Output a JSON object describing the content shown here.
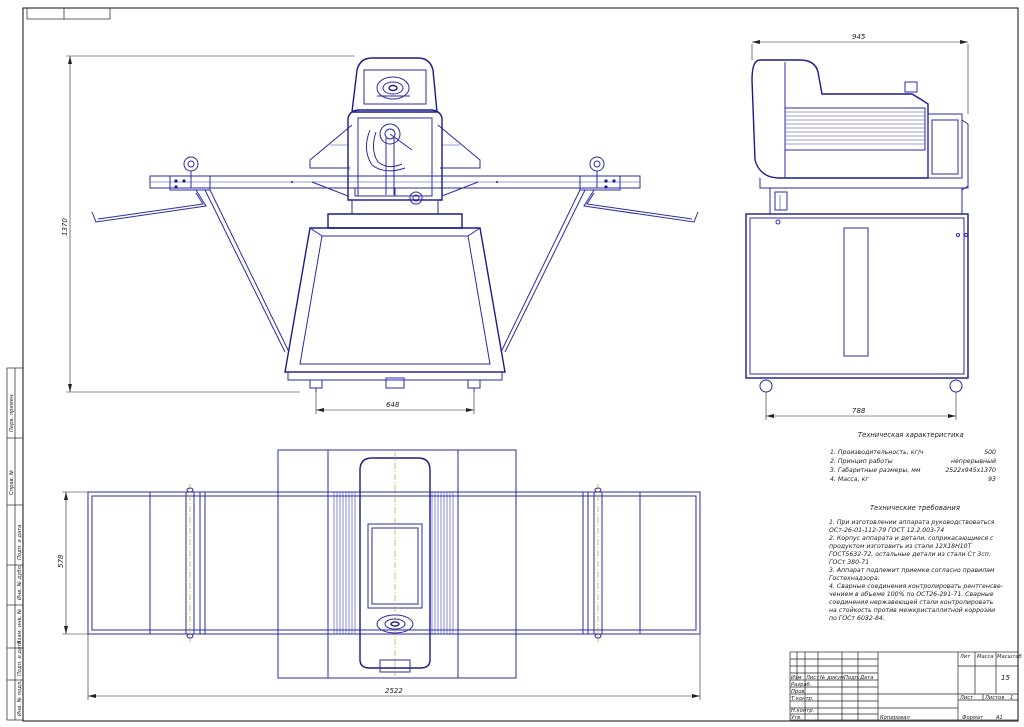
{
  "drawing": {
    "dimensions": {
      "front_height": "1370",
      "front_base_width": "648",
      "side_depth": "945",
      "side_base_width": "788",
      "top_width": "578",
      "top_length": "2522"
    },
    "tech_characteristics": {
      "title": "Техническая характеристика",
      "rows": [
        {
          "label": "1. Производительность, кг/ч",
          "value": "500"
        },
        {
          "label": "2. Принцип работы",
          "value": "непрерывный"
        },
        {
          "label": "3. Габаритные размеры, мм",
          "value": "2522х945х1370"
        },
        {
          "label": "4. Масса, кг",
          "value": "93"
        }
      ]
    },
    "tech_requirements": {
      "title": "Технические требования",
      "lines": [
        "1. При изготовлении аппарата руководствоваться",
        "ОСт-26-01-112-79  ГОСТ 12.2.003-74",
        "2. Корпус аппарата и детали, соприкасающиеся с",
        "продуктом изготовить из стали 12Х18Н10Т",
        "ГОСТ5632-72, остальные детали из стали Ст 3сп.",
        "ГОСт 380-71",
        "3. Аппарат подлежит приемке согласно правилам",
        "Гостехнадзора.",
        "4. Сварные соединения контролировать рентгенсве-",
        "чением в объеме 100%  по ОСТ26-291-71. Сварные",
        "соединения нержавеющей стали контролировать",
        "на стойкость против межкристаллитной коррозии",
        "по ГОСт 6032-84."
      ]
    },
    "title_block": {
      "col_lit": "Лит",
      "col_mass": "Масса",
      "col_scale": "Масштаб",
      "scale_value": "15",
      "col_sheet": "Лист",
      "col_sheets": "Листов",
      "sheets_value": "1",
      "col_izm": "Изм",
      "col_list": "Лист",
      "col_doc": "№ докум.",
      "col_sign": "Подп.",
      "col_date": "Дата",
      "role_razrab": "Разраб.",
      "role_prov": "Пров.",
      "role_tkontr": "Т.контр.",
      "role_nkontr": "Н.контр.",
      "role_utv": "Утв."
    },
    "footer": {
      "copied": "Копировал",
      "format_label": "Формат",
      "format_value": "А1"
    },
    "side_stamps": [
      "Перв. примен.",
      "Справ. №",
      "Подп. и дата",
      "Инв. № дубл.",
      "Взам. инв. №",
      "Подп. и дата",
      "Инв. № подл."
    ]
  }
}
